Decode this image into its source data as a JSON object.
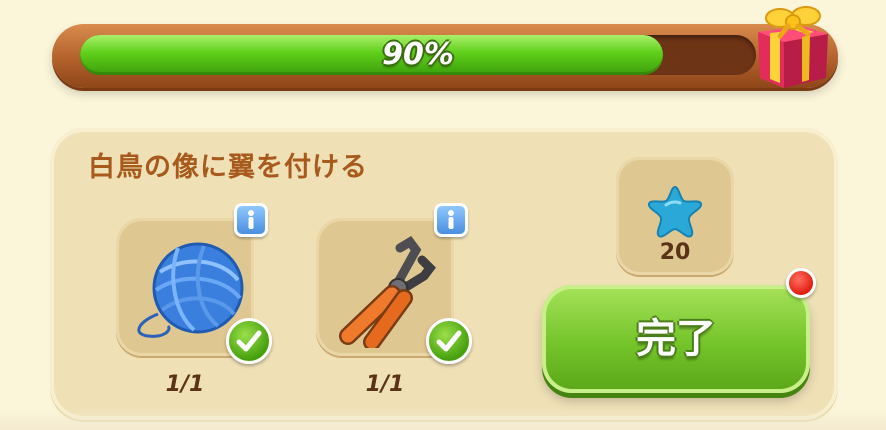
{
  "progress": {
    "value": 0.9,
    "label": "90%"
  },
  "task": {
    "title": "白鳥の像に翼を付ける",
    "items": [
      {
        "name": "yarn-ball-icon",
        "quantity": "1/1",
        "completed": true
      },
      {
        "name": "pliers-icon",
        "quantity": "1/1",
        "completed": true
      }
    ]
  },
  "reward": {
    "icon": "blue-star-icon",
    "count": "20"
  },
  "complete_button": {
    "label": "完了",
    "has_notification": true
  },
  "colors": {
    "progress_green": "#5fcf1a",
    "panel": "#efe0b6",
    "title": "#a75a1c",
    "button_green": "#74c42a",
    "notify_red": "#e21d12"
  }
}
